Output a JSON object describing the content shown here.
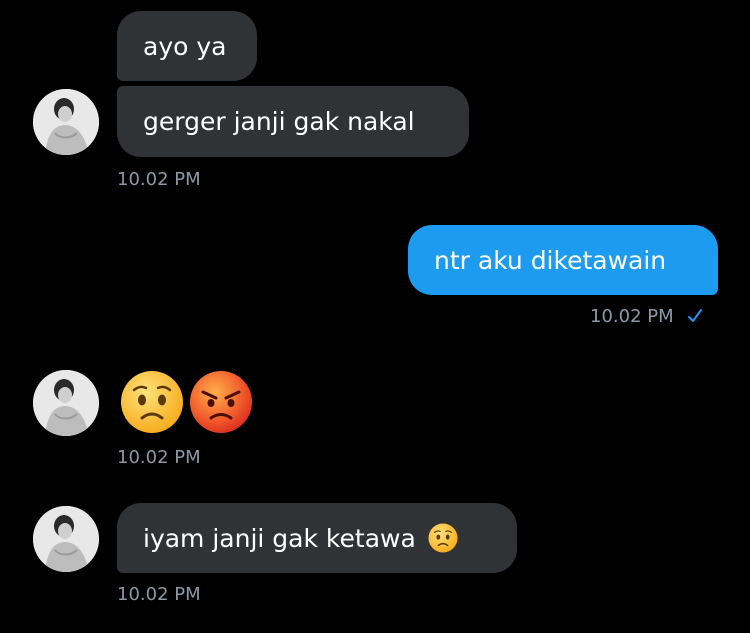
{
  "messages": [
    {
      "text": "ayo ya",
      "direction": "incoming"
    },
    {
      "text": "gerger janji gak nakal",
      "direction": "incoming",
      "time": "10.02 PM"
    },
    {
      "text": "ntr aku diketawain",
      "direction": "outgoing",
      "time": "10.02 PM",
      "status": "read-check-icon"
    },
    {
      "emojis": [
        "worried-face-emoji",
        "angry-face-emoji"
      ],
      "direction": "incoming",
      "time": "10.02 PM"
    },
    {
      "text": "iyam janji gak ketawa",
      "emoji": "worried-face-emoji",
      "direction": "incoming",
      "time": "10.02 PM"
    }
  ],
  "colors": {
    "background": "#000000",
    "incoming_bubble": "#2f3336",
    "outgoing_bubble": "#1d9bf0",
    "timestamp": "#8b98a5",
    "check": "#1d9bf0"
  }
}
